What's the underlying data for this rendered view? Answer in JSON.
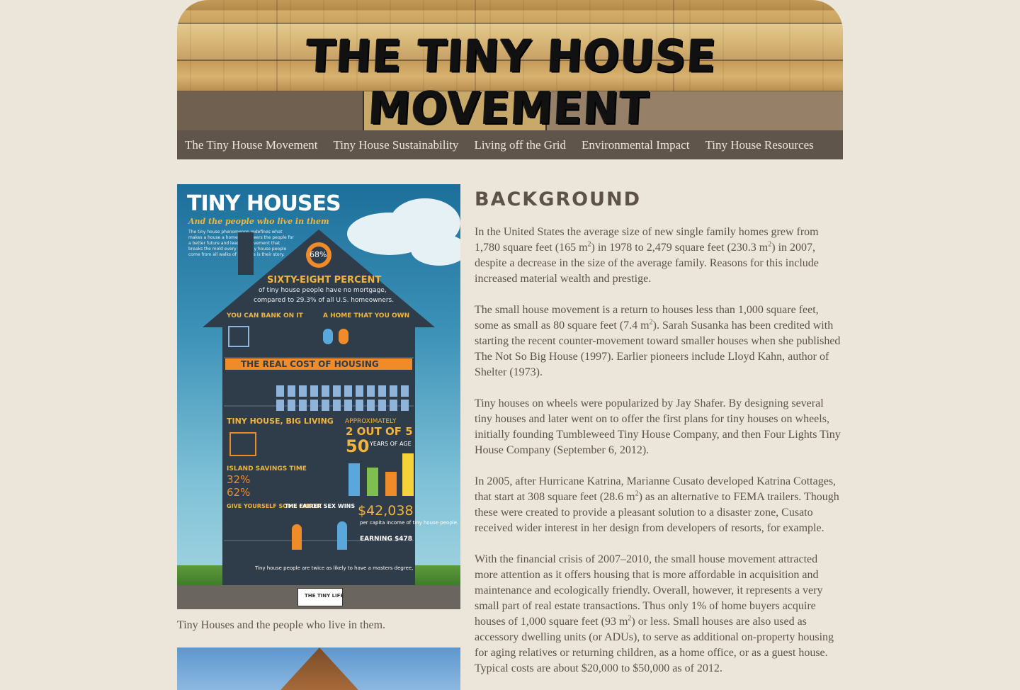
{
  "header": {
    "site_title": "THE TINY HOUSE MOVEMENT"
  },
  "nav": {
    "items": [
      "The Tiny House Movement",
      "Tiny House Sustainability",
      "Living off the Grid",
      "Environmental Impact",
      "Tiny House Resources"
    ]
  },
  "infographic": {
    "title": "TINY HOUSES",
    "subtitle": "And the people who live in them",
    "blurb": "The tiny house phenomenon redefines what makes a house a home, empowers the people for a better future and leads a movement that breaks the mold every day. Tiny house people come from all walks of life. This is their story.",
    "pct": "68%",
    "sixty_eight": "SIXTY-EIGHT PERCENT",
    "mortgage_line_1": "of tiny house people have no mortgage,",
    "mortgage_line_2": "compared to 29.3% of all U.S. homeowners.",
    "bank_heading": "YOU CAN BANK ON IT",
    "own_heading": "A HOME THAT YOU OWN",
    "cost_heading": "THE REAL COST OF HOUSING",
    "big_living": "TINY HOUSE, BIG LIVING",
    "two_of_five": "2 OUT OF 5",
    "approximately": "APPROXIMATELY",
    "fifty": "50",
    "years": "YEARS OF AGE",
    "island": "ISLAND SAVINGS TIME",
    "p32": "32%",
    "p62": "62%",
    "give_credit": "GIVE YOURSELF SOME CREDIT",
    "fairer_sex": "THE FAIRER SEX WINS",
    "income": "$42,038",
    "income_label": "per capita income of tiny house people.",
    "earning": "EARNING $478",
    "masters": "Tiny house people are twice as likely to have a masters degree,",
    "logo": "THE TINY LIFE"
  },
  "left": {
    "caption": "Tiny Houses and the people who live in them."
  },
  "article": {
    "heading": "Background",
    "p1_a": "In the United States the average size of new single family homes grew from 1,780 square feet (165 m",
    "p1_b": ") in 1978 to 2,479 square feet (230.3 m",
    "p1_c": ") in 2007, despite a decrease in the size of the average family. Reasons for this include increased material wealth and prestige.",
    "p2_a": "The small house movement is a return to houses less than 1,000 square feet, some as small as 80 square feet (7.4 m",
    "p2_b": "). Sarah Susanka has been credited with starting the recent counter-movement toward smaller houses when she published The Not So Big House (1997). Earlier pioneers include Lloyd Kahn, author of Shelter (1973).",
    "p3": "Tiny houses on wheels were popularized by Jay Shafer. By designing several tiny houses and later went on to offer the first plans for tiny houses on wheels, initially founding Tumbleweed Tiny House Company, and then Four Lights Tiny House Company (September 6, 2012).",
    "p4_a": "In 2005, after Hurricane Katrina, Marianne Cusato developed Katrina Cottages, that start at 308 square feet (28.6 m",
    "p4_b": ") as an alternative to FEMA trailers. Though these were created to provide a pleasant solution to a disaster zone, Cusato received wider interest in her design from developers of resorts, for example.",
    "p5_a": "With the financial crisis of 2007–2010, the small house movement attracted more attention as it offers housing that is more affordable in acquisition and maintenance and ecologically friendly. Overall, however, it represents a very small part of real estate transactions. Thus only 1% of home buyers acquire houses of 1,000 square feet (93 m",
    "p5_b": ") or less. Small houses are also used as accessory dwelling units (or ADUs), to serve as additional on-property housing for aging relatives or returning children, as a home office, or as a guest house. Typical costs are about $20,000 to $50,000 as of 2012.",
    "sup": "2"
  }
}
